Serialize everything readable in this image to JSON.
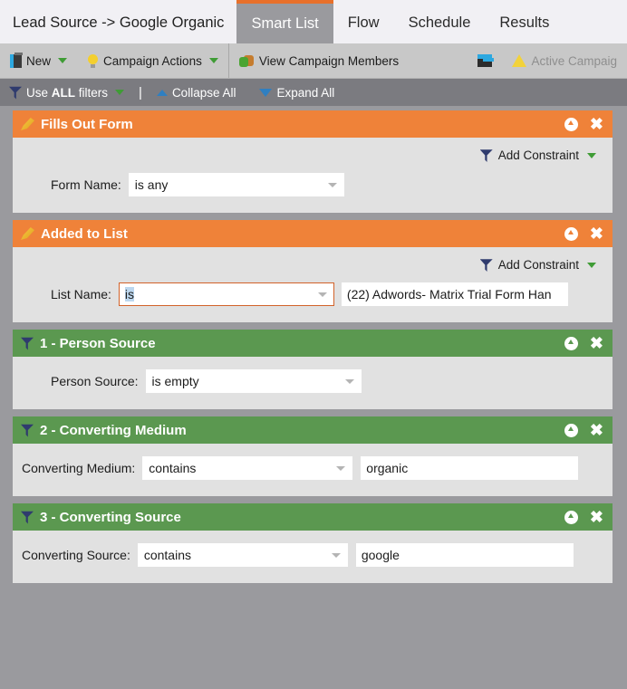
{
  "tabs": [
    {
      "label": "Lead Source -> Google Organic",
      "active": false,
      "kind": "title"
    },
    {
      "label": "Smart List",
      "active": true,
      "kind": "tab"
    },
    {
      "label": "Flow",
      "active": false,
      "kind": "tab"
    },
    {
      "label": "Schedule",
      "active": false,
      "kind": "tab"
    },
    {
      "label": "Results",
      "active": false,
      "kind": "tab"
    }
  ],
  "toolbar": {
    "new_label": "New",
    "campaign_actions_label": "Campaign Actions",
    "view_members_label": "View Campaign Members",
    "active_campaign_label": "Active Campaig"
  },
  "filterbar": {
    "use_filters_prefix": "Use ",
    "use_filters_strong": "ALL",
    "use_filters_suffix": " filters",
    "divider": "|",
    "collapse_all": "Collapse All",
    "expand_all": "Expand All"
  },
  "add_constraint_label": "Add Constraint",
  "panels": [
    {
      "title": "Fills Out Form",
      "color": "orange",
      "icon": "pencil-icon",
      "has_add_constraint": true,
      "field_label": "Form Name:",
      "operator": "is any",
      "operator_focused": false,
      "operator_selected": false,
      "value": null,
      "indent": true
    },
    {
      "title": "Added to List",
      "color": "orange",
      "icon": "pencil-icon",
      "has_add_constraint": true,
      "field_label": "List Name:",
      "operator": "is",
      "operator_focused": true,
      "operator_selected": true,
      "value": "(22) Adwords- Matrix Trial Form Han",
      "indent": true
    },
    {
      "title": "1 - Person Source",
      "color": "green",
      "icon": "funnel-icon",
      "has_add_constraint": false,
      "field_label": "Person Source:",
      "operator": "is empty",
      "operator_focused": false,
      "operator_selected": false,
      "value": null,
      "indent": true
    },
    {
      "title": "2 - Converting Medium",
      "color": "green",
      "icon": "funnel-icon",
      "has_add_constraint": false,
      "field_label": "Converting Medium:",
      "operator": "contains",
      "operator_focused": false,
      "operator_selected": false,
      "value": "organic",
      "indent": false
    },
    {
      "title": "3 - Converting Source",
      "color": "green",
      "icon": "funnel-icon",
      "has_add_constraint": false,
      "field_label": "Converting Source:",
      "operator": "contains",
      "operator_focused": false,
      "operator_selected": false,
      "value": "google",
      "indent": false
    }
  ],
  "colors": {
    "orange_header": "#ef8239",
    "green_header": "#5b9850",
    "active_tab_accent": "#e8702a",
    "canvas": "#9a9a9e",
    "panel_body": "#e1e1e1"
  }
}
